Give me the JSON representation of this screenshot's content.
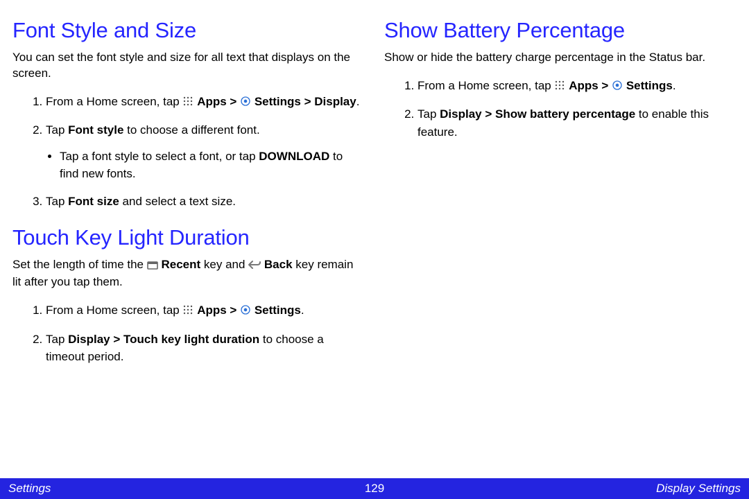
{
  "left": {
    "sec1": {
      "heading": "Font Style and Size",
      "intro": "You can set the font style and size for all text that displays on the screen.",
      "step1_pre": "From a Home screen, tap ",
      "step1_apps": "Apps > ",
      "step1_settings": "Settings > Display",
      "step1_post": ".",
      "step2_pre": "Tap ",
      "step2_bold": "Font style",
      "step2_post": " to choose a different font.",
      "step2_bullet_pre": "Tap a font style to select a font, or tap ",
      "step2_bullet_bold": "DOWNLOAD",
      "step2_bullet_post": " to find new fonts.",
      "step3_pre": "Tap ",
      "step3_bold": "Font size",
      "step3_post": " and select a text size."
    },
    "sec2": {
      "heading": "Touch Key Light Duration",
      "intro_pre": "Set the length of time the ",
      "intro_recent": "Recent",
      "intro_mid": " key and ",
      "intro_back": "Back",
      "intro_post": " key remain lit after you tap them.",
      "step1_pre": "From a Home screen, tap ",
      "step1_apps": "Apps > ",
      "step1_settings": "Settings",
      "step1_post": ".",
      "step2_pre": "Tap ",
      "step2_bold": "Display > Touch key light duration",
      "step2_post": " to choose a timeout period."
    }
  },
  "right": {
    "sec1": {
      "heading": "Show Battery Percentage",
      "intro": "Show or hide the battery charge percentage in the Status bar.",
      "step1_pre": "From a Home screen, tap ",
      "step1_apps": "Apps > ",
      "step1_settings": "Settings",
      "step1_post": ".",
      "step2_pre": "Tap ",
      "step2_bold": "Display > Show battery percentage",
      "step2_post": " to enable this feature."
    }
  },
  "footer": {
    "left": "Settings",
    "page": "129",
    "right": "Display Settings"
  }
}
